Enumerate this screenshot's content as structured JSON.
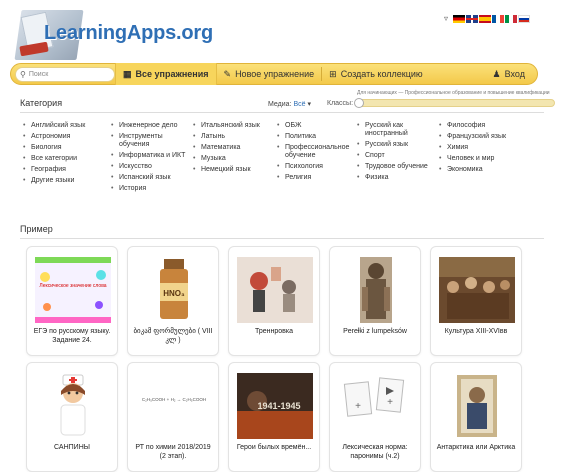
{
  "header": {
    "logo_text": "LearningApps.org",
    "language_arrow": "▿",
    "flags": [
      "de",
      "gb",
      "es",
      "fr",
      "it",
      "ru"
    ]
  },
  "toolbar": {
    "search_placeholder": "Поиск",
    "all_exercises": "Все упражнения",
    "new_exercise": "Новое упражнение",
    "create_collection": "Создать коллекцию",
    "login": "Вход"
  },
  "category": {
    "title": "Категория",
    "media_label": "Медиа:",
    "media_value": "Всё",
    "classes_label": "Классы:",
    "slider_caption": "Для начинающих — Профессиональное образование и повышение квалификации",
    "columns": [
      [
        "Английский язык",
        "Астрономия",
        "Биология",
        "Все категории",
        "География",
        "Другие языки"
      ],
      [
        "Инженерное дело",
        "Инструменты обучения",
        "Информатика и ИКТ",
        "Искусство",
        "Испанский язык",
        "История"
      ],
      [
        "Итальянский язык",
        "Латынь",
        "Математика",
        "Музыка",
        "Немецкий язык"
      ],
      [
        "ОБЖ",
        "Политика",
        "Профессиональное обучение",
        "Психология",
        "Религия"
      ],
      [
        "Русский как иностранный",
        "Русский язык",
        "Спорт",
        "Трудовое обучение",
        "Физика"
      ],
      [
        "Философия",
        "Французский язык",
        "Химия",
        "Человек и мир",
        "Экономика"
      ]
    ]
  },
  "examples": {
    "title": "Пример",
    "cards": [
      {
        "caption": "ЕГЭ по русскому языку. Задание 24.",
        "thumb_label": "Лексическое значение слова"
      },
      {
        "caption": "ბიკამ ფორმულები ( VIII კლ )",
        "thumb_label": "HNO₃"
      },
      {
        "caption": "Треннровка"
      },
      {
        "caption": "Perełki z lumpeksów"
      },
      {
        "caption": "Культура XIII-XVIвв"
      },
      {
        "caption": "САНПИНЫ"
      },
      {
        "caption": "РТ по химии 2018/2019 (2 этап).",
        "thumb_label": "C₂H₅COOH + H₂ → C₂H₅COOH"
      },
      {
        "caption": "Герои былых времён...",
        "thumb_label": "1941-1945"
      },
      {
        "caption": "Лексическая норма: паронимы (ч.2)"
      },
      {
        "caption": "Антарктика или Арктика"
      }
    ]
  },
  "colors": {
    "toolbar": "#f3c94a",
    "logo_blue": "#2f6fb5",
    "accent_red": "#c0392b"
  }
}
